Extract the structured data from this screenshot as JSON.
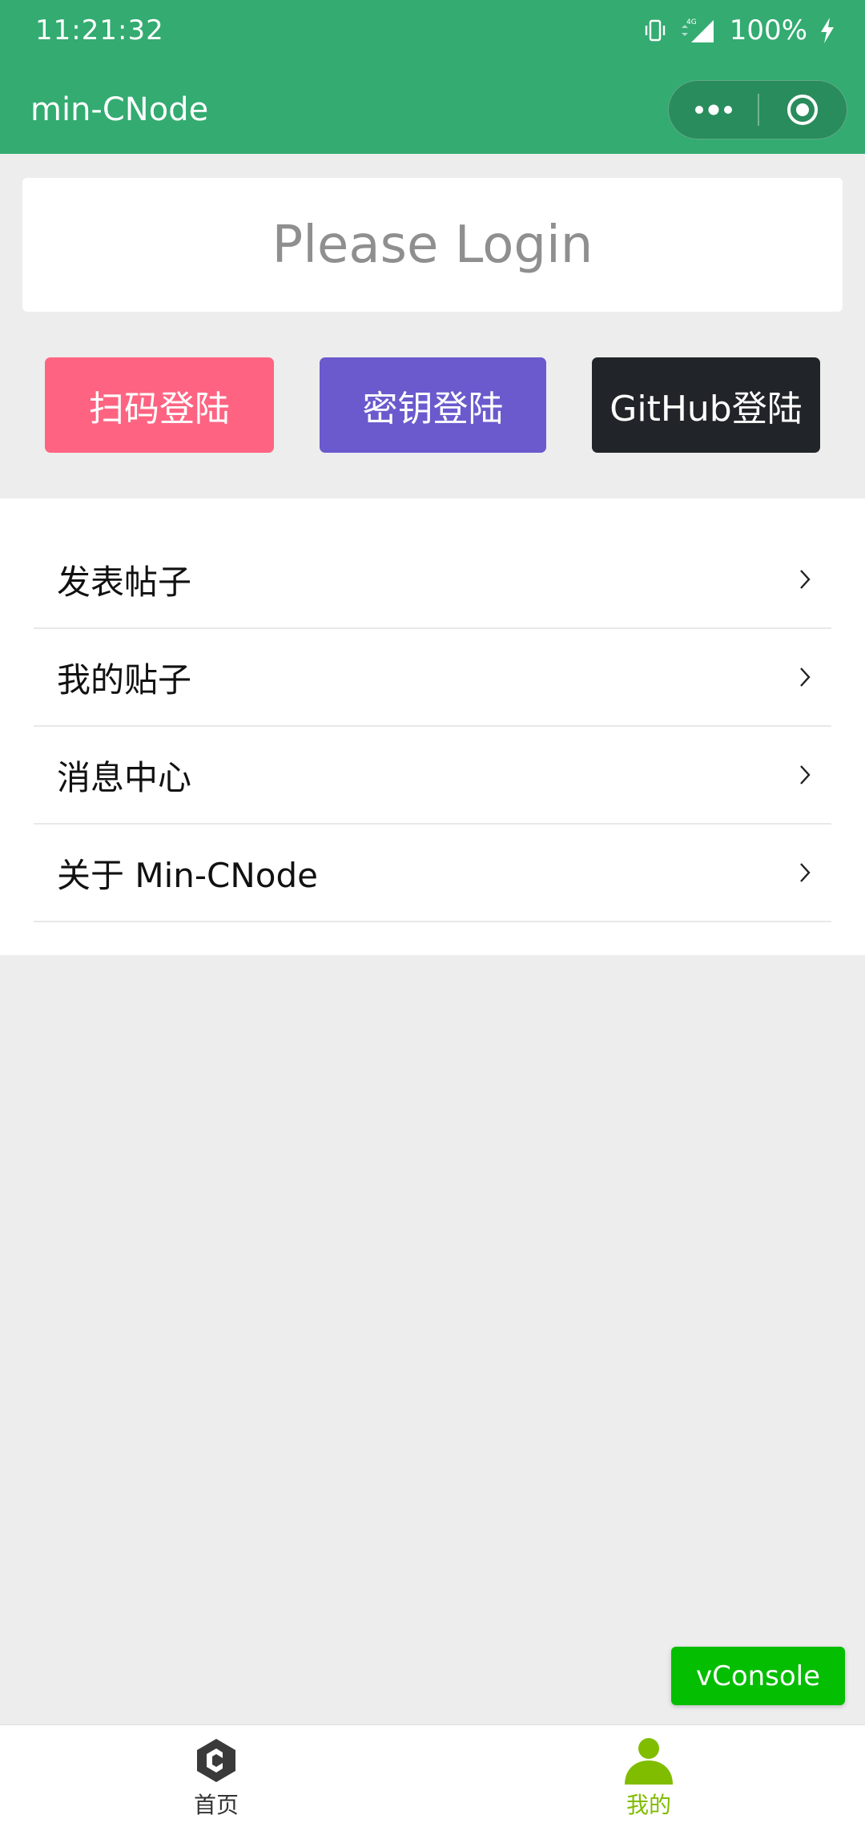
{
  "status_bar": {
    "time": "11:21:32",
    "network": "4G",
    "battery": "100%"
  },
  "nav": {
    "title": "min-CNode"
  },
  "login": {
    "title": "Please Login"
  },
  "buttons": [
    {
      "label": "扫码登陆",
      "color": "#fe6482"
    },
    {
      "label": "密钥登陆",
      "color": "#6a5acd"
    },
    {
      "label": "GitHub登陆",
      "color": "#212529"
    }
  ],
  "menu": {
    "items": [
      {
        "label": "发表帖子"
      },
      {
        "label": "我的贴子"
      },
      {
        "label": "消息中心"
      },
      {
        "label": "关于 Min-CNode"
      }
    ]
  },
  "vconsole": {
    "label": "vConsole"
  },
  "tabbar": {
    "items": [
      {
        "label": "首页",
        "icon": "cnode-logo-icon",
        "active": false
      },
      {
        "label": "我的",
        "icon": "user-icon",
        "active": true
      }
    ]
  },
  "colors": {
    "header_green": "#33ab71",
    "active_tab": "#80bd01",
    "vconsole_green": "#04be02"
  }
}
